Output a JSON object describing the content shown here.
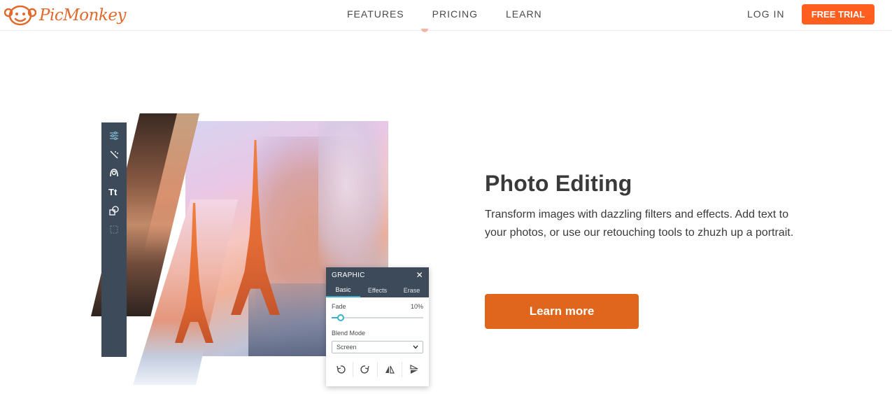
{
  "nav": {
    "logo_text": "PicMonkey",
    "links": [
      "FEATURES",
      "PRICING",
      "LEARN"
    ],
    "login": "LOG IN",
    "trial": "FREE TRIAL"
  },
  "panel": {
    "title": "GRAPHIC",
    "tabs": [
      "Basic",
      "Effects",
      "Erase"
    ],
    "active_tab": "Basic",
    "fade_label": "Fade",
    "fade_value": "10%",
    "fade_fraction": 0.1,
    "blend_label": "Blend Mode",
    "blend_value": "Screen"
  },
  "content": {
    "title": "Photo Editing",
    "description": "Transform images with dazzling filters and effects. Add text to your photos, or use our retouching tools to zhuzh up a portrait.",
    "cta": "Learn more"
  },
  "colors": {
    "brand_orange": "#ff5e1f",
    "cta_orange": "#e0661d",
    "panel_dark": "#3d4a5a",
    "accent_teal": "#36b3c8"
  }
}
